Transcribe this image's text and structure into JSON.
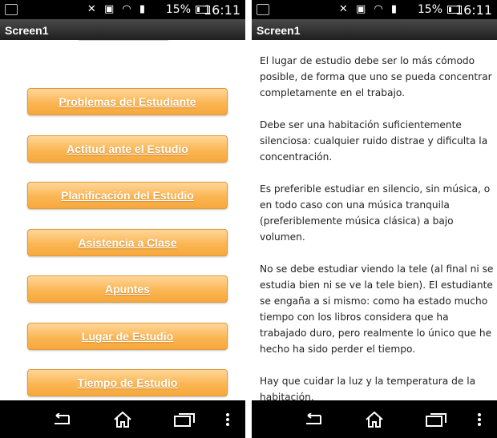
{
  "status_bar": {
    "icons": [
      "bluetooth-off-icon",
      "nfc-icon",
      "wifi-icon",
      "signal-icon"
    ],
    "battery_percent": "15%",
    "time": "16:11"
  },
  "app": {
    "title": "Screen1"
  },
  "menu": {
    "buttons": [
      "Problemas del Estudiante",
      "Actitud ante el Estudio",
      "Planificación del Estudio",
      "Asistencia a Clase",
      "Apuntes",
      "Lugar de Estudio",
      "Tiempo de Estudio"
    ]
  },
  "article": {
    "paragraphs": [
      "El lugar de estudio debe ser lo más cómodo posible, de forma que uno se pueda concentrar completamente en el trabajo.",
      "Debe ser una habitación suficientemente silenciosa: cualquier ruido distrae y dificulta la concentración.",
      "Es preferible estudiar en silencio, sin música, o en todo caso con una música tranquila (preferiblemente música clásica) a bajo volumen.",
      "No se debe estudiar viendo la tele (al final ni se estudia bien ni se ve la tele bien). El estudiante se engaña a si mismo: como ha estado mucho tiempo con los libros considera que ha trabajado duro, pero realmente lo único que he hecho ha sido perder el tiempo.",
      "Hay que cuidar la luz y la temperatura de la habitación."
    ]
  },
  "nav": [
    "back-icon",
    "home-icon",
    "recent-apps-icon",
    "menu-dots-icon"
  ],
  "colors": {
    "button": "#fbb653",
    "status_bar": "#000000",
    "title_bar": "#333333"
  }
}
